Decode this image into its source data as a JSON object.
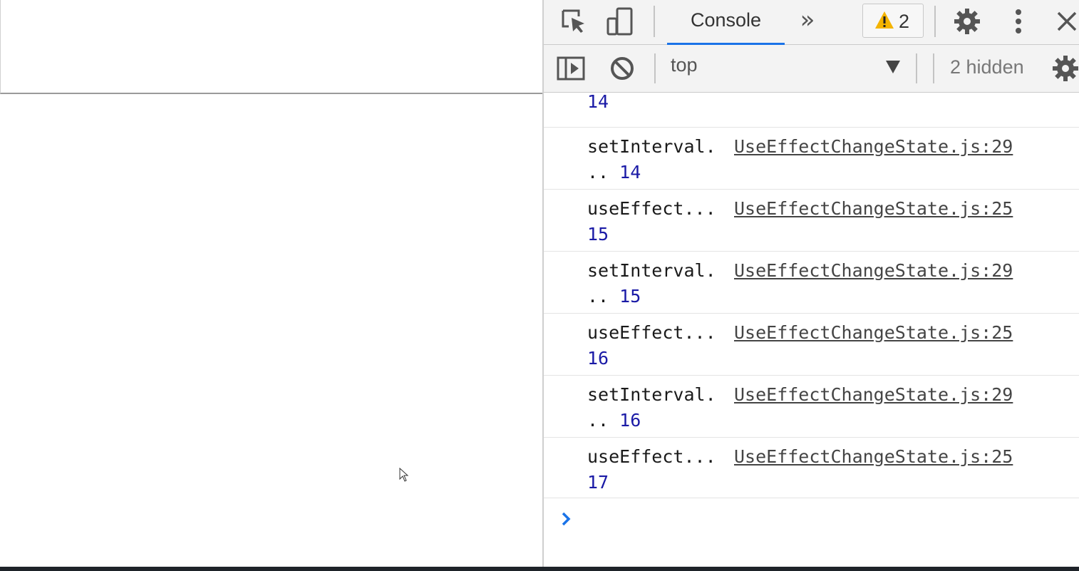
{
  "devtools": {
    "tabs": {
      "console_label": "Console",
      "more_tabs_label": "»"
    },
    "warnings": {
      "count": "2"
    },
    "toolbar": {
      "context": "top",
      "hidden_count": "2 hidden"
    }
  },
  "console": {
    "partial_row_value": "14",
    "rows": [
      {
        "line1": "setInterval.",
        "cont": "..",
        "value": "14",
        "source": "UseEffectChangeState.js:29"
      },
      {
        "line1": "useEffect...",
        "cont": "",
        "value": "15",
        "source": "UseEffectChangeState.js:25"
      },
      {
        "line1": "setInterval.",
        "cont": "..",
        "value": "15",
        "source": "UseEffectChangeState.js:29"
      },
      {
        "line1": "useEffect...",
        "cont": "",
        "value": "16",
        "source": "UseEffectChangeState.js:25"
      },
      {
        "line1": "setInterval.",
        "cont": "..",
        "value": "16",
        "source": "UseEffectChangeState.js:29"
      },
      {
        "line1": "useEffect...",
        "cont": "",
        "value": "17",
        "source": "UseEffectChangeState.js:25"
      }
    ]
  },
  "icons": {
    "inspect": "inspect-element-icon",
    "device": "device-toolbar-icon",
    "warning": "warning-triangle-icon",
    "settings": "gear-icon",
    "menu": "kebab-menu-icon",
    "close": "close-icon",
    "sidebar": "show-sidebar-icon",
    "clear": "clear-console-icon",
    "prompt": "prompt-chevron-icon"
  },
  "colors": {
    "accent": "#1a73e8",
    "number": "#1a1aa6",
    "warning": "#f4b400"
  }
}
